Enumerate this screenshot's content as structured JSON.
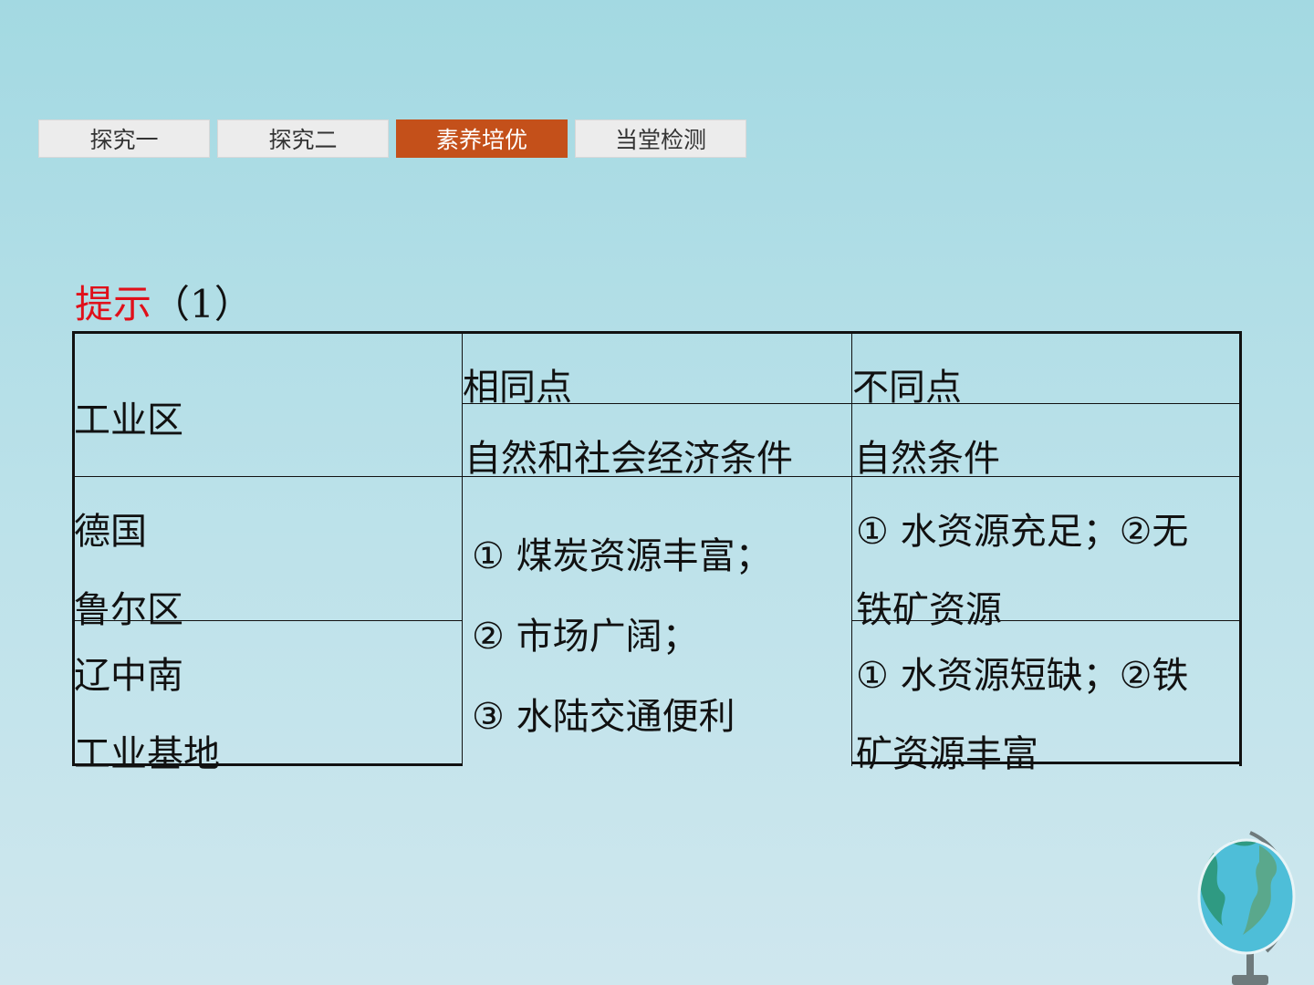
{
  "tabs": [
    {
      "label": "探究一",
      "active": false
    },
    {
      "label": "探究二",
      "active": false
    },
    {
      "label": "素养培优",
      "active": true
    },
    {
      "label": "当堂检测",
      "active": false
    }
  ],
  "hint": {
    "label": "提示",
    "paren_open": "（",
    "number": "1",
    "paren_close": "）"
  },
  "table": {
    "header": {
      "col1": "工业区",
      "col2_title": "相同点",
      "col2_sub": "自然和社会经济条件",
      "col3_title": "不同点",
      "col3_sub": "自然条件"
    },
    "rows": [
      {
        "region_line1": "德国",
        "region_line2": "鲁尔区",
        "diff_line1": "① 水资源充足；②无",
        "diff_line2": "铁矿资源"
      },
      {
        "region_line1": "辽中南",
        "region_line2": "工业基地",
        "diff_line1": "① 水资源短缺；②铁",
        "diff_line2": "矿资源丰富"
      }
    ],
    "common": [
      "① 煤炭资源丰富；",
      "② 市场广阔；",
      "③ 水陆交通便利"
    ]
  },
  "colors": {
    "active_tab": "#c4501a",
    "hint_red": "#e0101a"
  },
  "icons": {
    "corner": "globe-icon"
  }
}
